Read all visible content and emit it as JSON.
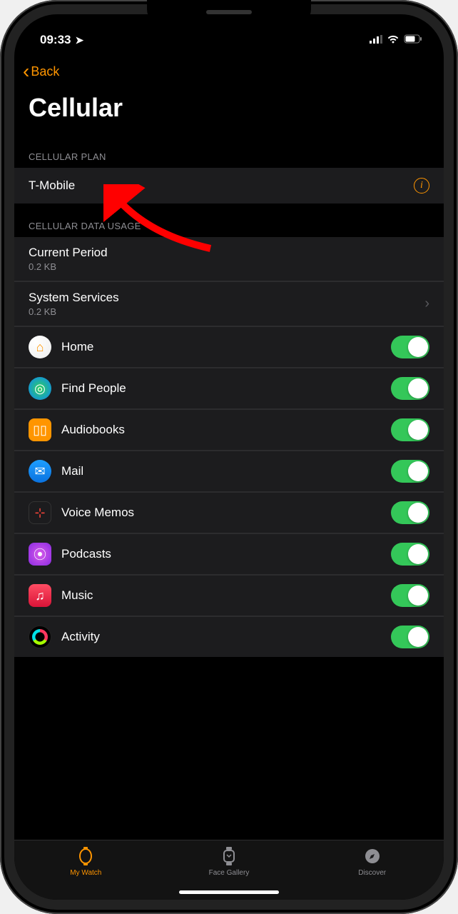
{
  "status": {
    "time": "09:33"
  },
  "nav": {
    "back_label": "Back",
    "title": "Cellular"
  },
  "sections": {
    "plan_header": "CELLULAR PLAN",
    "plan": {
      "carrier": "T-Mobile"
    },
    "usage_header": "CELLULAR DATA USAGE",
    "current": {
      "title": "Current Period",
      "value": "0.2 KB"
    },
    "system": {
      "title": "System Services",
      "value": "0.2 KB"
    },
    "apps": [
      {
        "name": "Home",
        "enabled": true
      },
      {
        "name": "Find People",
        "enabled": true
      },
      {
        "name": "Audiobooks",
        "enabled": true
      },
      {
        "name": "Mail",
        "enabled": true
      },
      {
        "name": "Voice Memos",
        "enabled": true
      },
      {
        "name": "Podcasts",
        "enabled": true
      },
      {
        "name": "Music",
        "enabled": true
      },
      {
        "name": "Activity",
        "enabled": true
      }
    ]
  },
  "tabs": {
    "my_watch": "My Watch",
    "face_gallery": "Face Gallery",
    "discover": "Discover"
  },
  "colors": {
    "accent": "#ff9500",
    "switch_on": "#34c759"
  }
}
